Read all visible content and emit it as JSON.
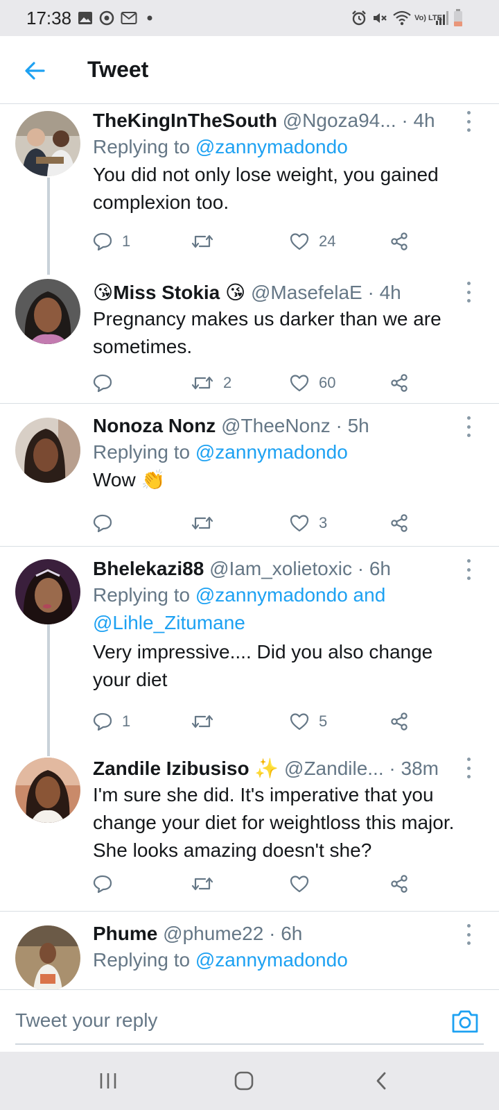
{
  "status_bar": {
    "time": "17:38",
    "signal_label": "Vo) LTE"
  },
  "header": {
    "title": "Tweet"
  },
  "replying_label": "Replying to",
  "tweets": [
    {
      "name": "TheKingInTheSouth",
      "handle": "@Ngoza94...",
      "time": "· 4h",
      "reply_to": "@zannymadondo",
      "text": "You did not only lose weight, you gained complexion too.",
      "counts": {
        "reply": "1",
        "retweet": "",
        "like": "24"
      }
    },
    {
      "name": "😘Miss Stokia 😘",
      "handle": "@MasefelaE",
      "time": "· 4h",
      "text": "Pregnancy makes us darker than we are sometimes.",
      "counts": {
        "reply": "",
        "retweet": "2",
        "like": "60"
      }
    },
    {
      "name": "Nonoza Nonz",
      "handle": "@TheeNonz",
      "time": "· 5h",
      "reply_to": "@zannymadondo",
      "text": "Wow 👏",
      "counts": {
        "reply": "",
        "retweet": "",
        "like": "3"
      }
    },
    {
      "name": "Bhelekazi88",
      "handle": "@Iam_xolietoxic",
      "time": "· 6h",
      "reply_to": "@zannymadondo and @Lihle_Zitumane",
      "text": "Very impressive.... Did you also change your diet",
      "counts": {
        "reply": "1",
        "retweet": "",
        "like": "5"
      }
    },
    {
      "name": "Zandile Izibusiso ✨",
      "handle": "@Zandile...",
      "time": "· 38m",
      "text": "I'm sure she did. It's imperative that you change your diet for weightloss this major. She looks amazing doesn't she?",
      "counts": {
        "reply": "",
        "retweet": "",
        "like": ""
      }
    },
    {
      "name": "Phume",
      "handle": "@phume22",
      "time": "· 6h",
      "reply_to": "@zannymadondo"
    }
  ],
  "reply_bar": {
    "placeholder": "Tweet your reply"
  },
  "colors": {
    "accent": "#1da1f2",
    "secondary_text": "#657786",
    "divider": "#d8dee3"
  },
  "icons": [
    "back-arrow-icon",
    "reply-icon",
    "retweet-icon",
    "like-icon",
    "share-icon",
    "more-icon",
    "camera-icon",
    "recents-icon",
    "home-icon",
    "nav-back-icon"
  ]
}
